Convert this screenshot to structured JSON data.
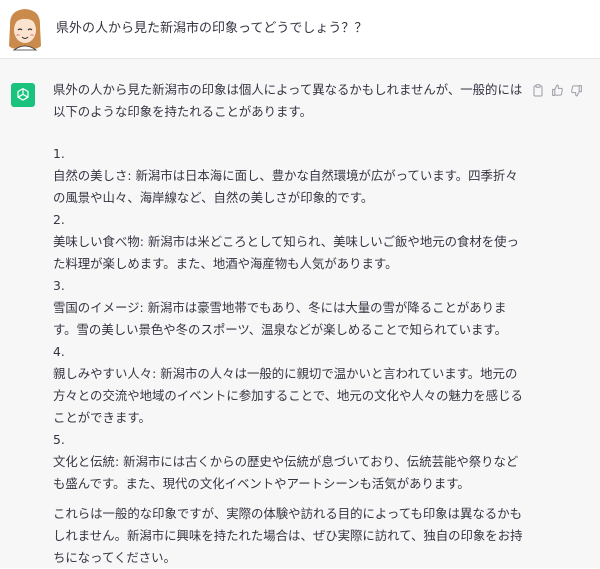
{
  "user": {
    "message": "県外の人から見た新潟市の印象ってどうでしょう？？"
  },
  "assistant": {
    "intro": "県外の人から見た新潟市の印象は個人によって異なるかもしれませんが、一般的には以下のような印象を持たれることがあります。",
    "items": [
      {
        "num": "1.",
        "text": "自然の美しさ: 新潟市は日本海に面し、豊かな自然環境が広がっています。四季折々の風景や山々、海岸線など、自然の美しさが印象的です。"
      },
      {
        "num": "2.",
        "text": "美味しい食べ物: 新潟市は米どころとして知られ、美味しいご飯や地元の食材を使った料理が楽しめます。また、地酒や海産物も人気があります。"
      },
      {
        "num": "3.",
        "text": "雪国のイメージ: 新潟市は豪雪地帯でもあり、冬には大量の雪が降ることがあります。雪の美しい景色や冬のスポーツ、温泉などが楽しめることで知られています。"
      },
      {
        "num": "4.",
        "text": "親しみやすい人々: 新潟市の人々は一般的に親切で温かいと言われています。地元の方々との交流や地域のイベントに参加することで、地元の文化や人々の魅力を感じることができます。"
      },
      {
        "num": "5.",
        "text": "文化と伝統: 新潟市には古くからの歴史や伝統が息づいており、伝統芸能や祭りなども盛んです。また、現代の文化イベントやアートシーンも活気があります。"
      }
    ],
    "closing": "これらは一般的な印象ですが、実際の体験や訪れる目的によっても印象は異なるかもしれません。新潟市に興味を持たれた場合は、ぜひ実際に訪れて、独自の印象をお持ちになってください。"
  },
  "icons": {
    "user_avatar": "user-avatar-illustration",
    "assistant_avatar": "openai-logo-icon",
    "copy": "clipboard-icon",
    "like": "thumbs-up-icon",
    "dislike": "thumbs-down-icon"
  },
  "colors": {
    "assistant_bg": "#f7f7f8",
    "brand_green": "#19c37d",
    "text": "#343541"
  }
}
